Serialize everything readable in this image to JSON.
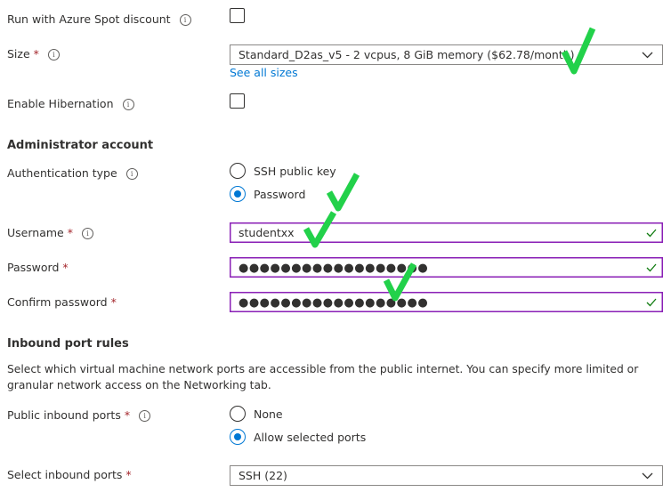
{
  "spot": {
    "label": "Run with Azure Spot discount",
    "checked": false
  },
  "size": {
    "label": "Size",
    "required": "*",
    "value": "Standard_D2as_v5 - 2 vcpus, 8 GiB memory ($62.78/month)",
    "see_all_link": "See all sizes"
  },
  "hibernation": {
    "label": "Enable Hibernation",
    "checked": false
  },
  "admin": {
    "heading": "Administrator account",
    "auth_label": "Authentication type",
    "auth_options": [
      "SSH public key",
      "Password"
    ],
    "auth_selected": "Password",
    "username_label": "Username",
    "username_value": "studentxx",
    "password_label": "Password",
    "password_value": "●●●●●●●●●●●●●●●●●●",
    "confirm_label": "Confirm password",
    "confirm_value": "●●●●●●●●●●●●●●●●●●",
    "required": "*"
  },
  "inbound": {
    "heading": "Inbound port rules",
    "description": "Select which virtual machine network ports are accessible from the public internet. You can specify more limited or granular network access on the Networking tab.",
    "public_label": "Public inbound ports",
    "public_options": [
      "None",
      "Allow selected ports"
    ],
    "public_selected": "Allow selected ports",
    "select_label": "Select inbound ports",
    "select_value": "SSH (22)",
    "required": "*"
  },
  "colors": {
    "accent": "#0078d4",
    "valid_border": "#8a1fb6",
    "valid_check": "#107c10",
    "required": "#a4262c",
    "annotation_check": "#22d14a"
  }
}
